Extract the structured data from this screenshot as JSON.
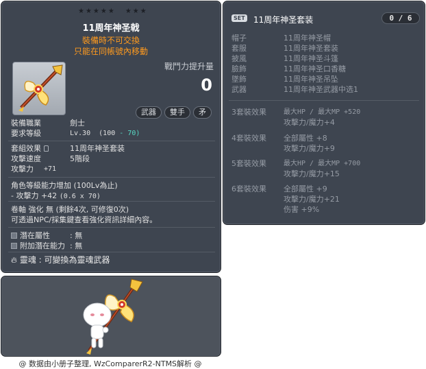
{
  "item_id": "01442248",
  "stars": {
    "group1": "★★★★★",
    "group2": "★★★"
  },
  "title": "11周年神圣戟",
  "warnings": [
    "裝備時不可交換",
    "只能在同帳號內移動"
  ],
  "power": {
    "label": "戰鬥力提升量",
    "value": "0"
  },
  "tags": [
    "武器",
    "雙手",
    "矛"
  ],
  "job": {
    "label": "裝備職業",
    "value": "劍士"
  },
  "req": {
    "label": "要求等級",
    "value_prefix": "Lv.30",
    "value_base": "(100",
    "value_bonus": "- 70)"
  },
  "set_effect": {
    "label": "套組效果",
    "value": "11周年神圣套装"
  },
  "attack_speed": {
    "label": "攻擊速度",
    "value": "5階段"
  },
  "attack": {
    "label": "攻擊力",
    "value": "+71"
  },
  "level_bonus": {
    "line1": "角色等級能力增加 (100Lv為止)",
    "line2_prefix": "- 攻擊力 +42",
    "line2_detail": "(0.6 x 70)"
  },
  "enhance": {
    "line1": "卷軸 強化 無 (剩餘4次, 可修復0次)",
    "line2": "可透過NPC/採集鍵查看強化資訊詳細內容。"
  },
  "potential": {
    "label": "潛在屬性",
    "value": ": 無"
  },
  "add_potential": {
    "label": "附加潛在能力",
    "value": ": 無"
  },
  "soul": {
    "label": "靈魂",
    "value": ": 可變換為靈魂武器"
  },
  "set_panel": {
    "badge": "SET",
    "name": "11周年神圣套装",
    "count": "0 / 6",
    "items": [
      {
        "k": "帽子",
        "v": "11周年神圣帽"
      },
      {
        "k": "套服",
        "v": "11周年神圣套装"
      },
      {
        "k": "披風",
        "v": "11周年神圣斗篷"
      },
      {
        "k": "臉飾",
        "v": "11周年神圣口香糖"
      },
      {
        "k": "墜飾",
        "v": "11周年神圣吊坠"
      },
      {
        "k": "武器",
        "v": "11周年神圣武器中选1"
      }
    ],
    "bonuses": [
      {
        "k": "3套裝效果",
        "lines": [
          "最大HP / 最大MP  +520",
          "攻擊力/魔力+4"
        ]
      },
      {
        "k": "4套裝效果",
        "lines": [
          "全部屬性 +8",
          "攻擊力/魔力+9"
        ]
      },
      {
        "k": "5套裝效果",
        "lines": [
          "最大HP / 最大MP  +700",
          "攻擊力/魔力+15"
        ]
      },
      {
        "k": "6套裝效果",
        "lines": [
          "全部屬性 +9",
          "攻擊力/魔力+21",
          "伤害 +9%"
        ]
      }
    ]
  },
  "footer": "@ 数据由小册子整理, WzComparerR2-NTMS解析 @",
  "colors": {
    "panel_bg": "#3e4550",
    "warning": "#ff9a1e",
    "bonus_cyan": "#57d8c4",
    "inactive_text": "#959ba4"
  }
}
